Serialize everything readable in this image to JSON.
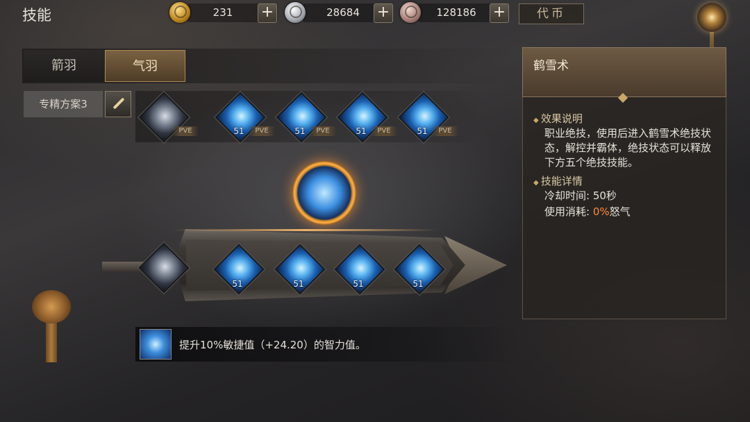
{
  "header": {
    "title": "技能",
    "currencies": [
      {
        "icon": "gold-coin-icon",
        "value": "231"
      },
      {
        "icon": "silver-coin-icon",
        "value": "28684"
      },
      {
        "icon": "bronze-coin-icon",
        "value": "128186"
      }
    ],
    "plus_label": "+",
    "daibi_label": "代币"
  },
  "tabs": [
    {
      "label": "箭羽",
      "active": false
    },
    {
      "label": "气羽",
      "active": true
    }
  ],
  "spec": {
    "label": "专精方案3"
  },
  "top_skills": [
    {
      "level": "",
      "tag": "PVE"
    },
    {
      "level": "51",
      "tag": "PVE"
    },
    {
      "level": "51",
      "tag": "PVE"
    },
    {
      "level": "51",
      "tag": "PVE"
    },
    {
      "level": "51",
      "tag": "PVE"
    }
  ],
  "sword_skills": [
    {
      "level": "51"
    },
    {
      "level": "51"
    },
    {
      "level": "51"
    },
    {
      "level": "51"
    }
  ],
  "buff": {
    "text": "提升10%敏捷值（+24.20）的智力值。"
  },
  "panel": {
    "title": "鹤雪术",
    "effect_header": "效果说明",
    "effect_text": "职业绝技，使用后进入鹤雪术绝技状态，解控并霸体，绝技状态可以释放下方五个绝技技能。",
    "detail_header": "技能详情",
    "cooldown_label": "冷却时间: ",
    "cooldown_value": "50秒",
    "cost_label": "使用消耗: ",
    "cost_value": "0%",
    "cost_unit": "怒气"
  },
  "colors": {
    "accent": "#c9a86a",
    "highlight": "#ff8a3a"
  }
}
